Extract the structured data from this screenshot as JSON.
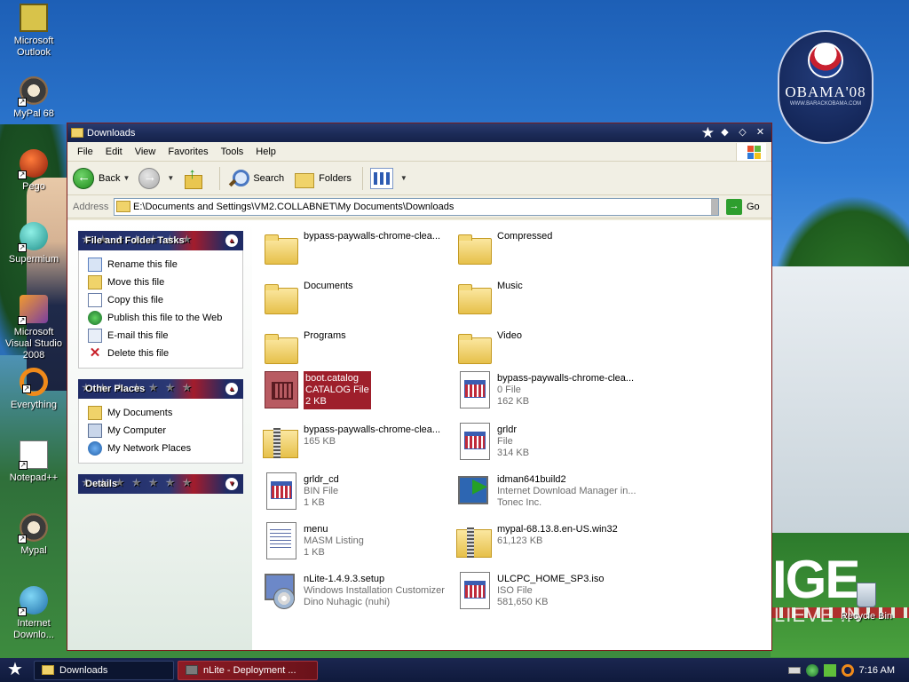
{
  "desktop": {
    "icons": [
      {
        "label": "Microsoft Outlook",
        "icon": "outlook-icon"
      },
      {
        "label": "MyPal 68",
        "icon": "raccoon-icon"
      },
      {
        "label": "Pego",
        "icon": "pego-icon"
      },
      {
        "label": "Supermium",
        "icon": "supermium-icon"
      },
      {
        "label": "Microsoft Visual Studio 2008",
        "icon": "visual-studio-icon"
      },
      {
        "label": "Everything",
        "icon": "everything-icon"
      },
      {
        "label": "Notepad++",
        "icon": "notepad-plus-icon"
      },
      {
        "label": "Mypal",
        "icon": "raccoon-icon"
      },
      {
        "label": "Internet Downlo...",
        "icon": "internet-download-manager-icon"
      }
    ],
    "recycle_bin": "Recycle Bin",
    "wallpaper": {
      "logo_word": "OBAMA'08",
      "logo_sub": "WWW.BARACKOBAMA.COM",
      "slogan_big": "IGE",
      "slogan_small": "LIEVE IN"
    }
  },
  "window": {
    "title": "Downloads",
    "menu": [
      "File",
      "Edit",
      "View",
      "Favorites",
      "Tools",
      "Help"
    ],
    "toolbar": {
      "back": "Back",
      "search": "Search",
      "folders": "Folders"
    },
    "address": {
      "label": "Address",
      "value": "E:\\Documents and Settings\\VM2.COLLABNET\\My Documents\\Downloads",
      "go": "Go"
    },
    "tasks_panels": {
      "file_folder_tasks": {
        "title": "File and Folder Tasks",
        "items": [
          "Rename this file",
          "Move this file",
          "Copy this file",
          "Publish this file to the Web",
          "E-mail this file",
          "Delete this file"
        ]
      },
      "other_places": {
        "title": "Other Places",
        "items": [
          "My Documents",
          "My Computer",
          "My Network Places"
        ]
      },
      "details": {
        "title": "Details"
      }
    },
    "files": [
      {
        "name": "bypass-paywalls-chrome-clea...",
        "type": "",
        "size": "",
        "kind": "folder"
      },
      {
        "name": "Compressed",
        "type": "",
        "size": "",
        "kind": "folder"
      },
      {
        "name": "Documents",
        "type": "",
        "size": "",
        "kind": "folder"
      },
      {
        "name": "Music",
        "type": "",
        "size": "",
        "kind": "folder"
      },
      {
        "name": "Programs",
        "type": "",
        "size": "",
        "kind": "folder"
      },
      {
        "name": "Video",
        "type": "",
        "size": "",
        "kind": "folder"
      },
      {
        "name": "boot.catalog",
        "type": "CATALOG File",
        "size": "2 KB",
        "kind": "catalog",
        "selected": true
      },
      {
        "name": "bypass-paywalls-chrome-clea...",
        "type": "0 File",
        "size": "162 KB",
        "kind": "doc"
      },
      {
        "name": "bypass-paywalls-chrome-clea...",
        "type": "165 KB",
        "size": "",
        "kind": "zip"
      },
      {
        "name": "grldr",
        "type": "File",
        "size": "314 KB",
        "kind": "doc"
      },
      {
        "name": "grldr_cd",
        "type": "BIN File",
        "size": "1 KB",
        "kind": "doc"
      },
      {
        "name": "idman641build2",
        "type": "Internet Download Manager in...",
        "size": "Tonec Inc.",
        "kind": "idm"
      },
      {
        "name": "menu",
        "type": "MASM Listing",
        "size": "1 KB",
        "kind": "text"
      },
      {
        "name": "mypal-68.13.8.en-US.win32",
        "type": "61,123 KB",
        "size": "",
        "kind": "zip"
      },
      {
        "name": "nLite-1.4.9.3.setup",
        "type": "Windows Installation Customizer",
        "size": "Dino Nuhagic (nuhi)",
        "kind": "setup"
      },
      {
        "name": "ULCPC_HOME_SP3.iso",
        "type": "ISO File",
        "size": "581,650 KB",
        "kind": "doc"
      }
    ]
  },
  "taskbar": {
    "buttons": [
      {
        "label": "Downloads",
        "active": true
      },
      {
        "label": "nLite - Deployment ...",
        "active": false
      }
    ],
    "clock": "7:16 AM"
  },
  "colors": {
    "titlebar": "#1c2b58",
    "selection": "#9e1f2b",
    "panel_head": "#2a3874"
  }
}
